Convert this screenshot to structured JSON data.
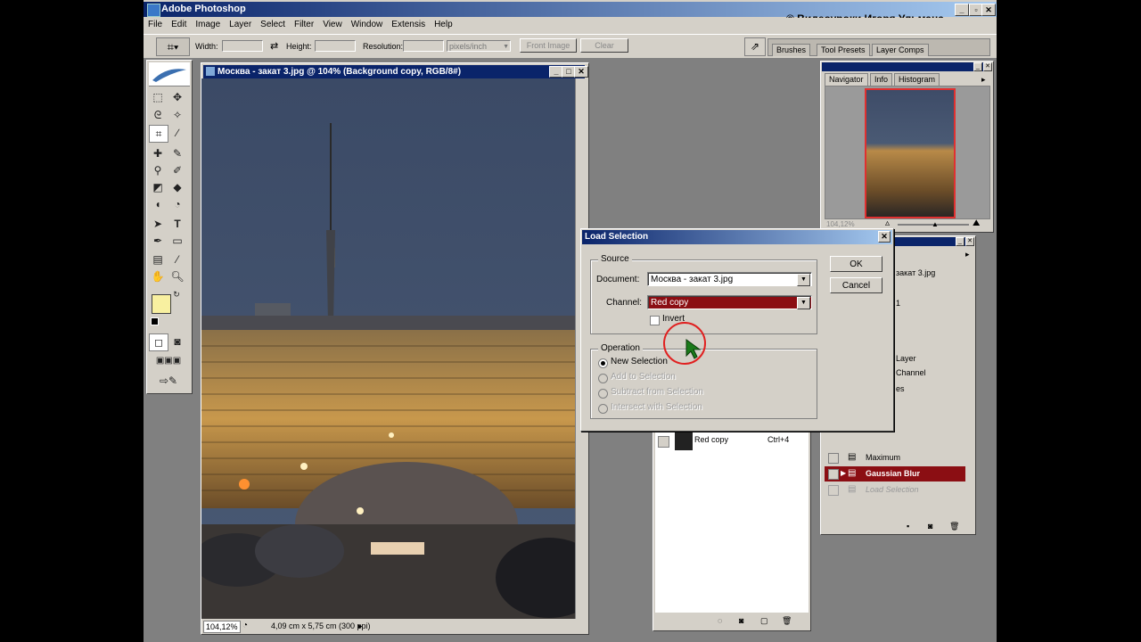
{
  "app": {
    "title": "Adobe Photoshop",
    "watermark": "© Видеоуроки Игоря Ульмана"
  },
  "menu": [
    "File",
    "Edit",
    "Image",
    "Layer",
    "Select",
    "Filter",
    "View",
    "Window",
    "Extensis",
    "Help"
  ],
  "options_bar": {
    "width_label": "Width:",
    "height_label": "Height:",
    "resolution_label": "Resolution:",
    "units": "pixels/inch",
    "front_image_label": "Front Image",
    "clear_label": "Clear",
    "palette_tabs": [
      "Brushes",
      "Tool Presets",
      "Layer Comps"
    ]
  },
  "document": {
    "title": "Москва - закат 3.jpg @ 104% (Background copy, RGB/8#)",
    "zoom": "104,12%",
    "info": "4,09 cm x 5,75 cm (300 ppi)"
  },
  "navigator": {
    "tabs": [
      "Navigator",
      "Info",
      "Histogram"
    ],
    "zoom": "104,12%"
  },
  "channels_panel": {
    "rows": [
      {
        "name": "Red copy",
        "shortcut": "Ctrl+4"
      }
    ]
  },
  "history_panel": {
    "partial_labels": [
      "закат 3.jpg",
      "1",
      "Layer",
      "Channel",
      "es"
    ],
    "items": [
      {
        "name": "Maximum",
        "state": "normal"
      },
      {
        "name": "Gaussian Blur",
        "state": "selected"
      },
      {
        "name": "Load Selection",
        "state": "disabled"
      }
    ]
  },
  "dialog": {
    "title": "Load Selection",
    "source_label": "Source",
    "document_label": "Document:",
    "document_value": "Москва - закат 3.jpg",
    "channel_label": "Channel:",
    "channel_value": "Red copy",
    "invert_label": "Invert",
    "operation_label": "Operation",
    "operations": [
      {
        "label": "New Selection",
        "checked": true,
        "enabled": true
      },
      {
        "label": "Add to Selection",
        "checked": false,
        "enabled": false
      },
      {
        "label": "Subtract from Selection",
        "checked": false,
        "enabled": false
      },
      {
        "label": "Intersect with Selection",
        "checked": false,
        "enabled": false
      }
    ],
    "ok_label": "OK",
    "cancel_label": "Cancel"
  },
  "colors": {
    "titlebar": "#0a246a",
    "chrome": "#d4d0c8",
    "workspace": "#808080",
    "highlight_red": "#8b0e13",
    "cursor_circle": "#e02020"
  }
}
